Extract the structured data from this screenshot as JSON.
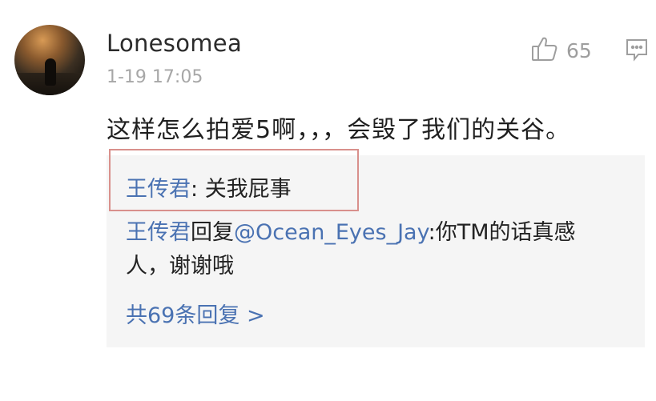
{
  "comment": {
    "username": "Lonesomea",
    "timestamp": "1-19 17:05",
    "like_count": "65",
    "text": "这样怎么拍爱5啊，，，会毁了我们的关谷。",
    "icons": {
      "like": "thumbs-up-icon",
      "reply": "comment-bubble-icon"
    }
  },
  "replies": [
    {
      "author": "王传君",
      "separator": ": ",
      "text": "关我屁事"
    },
    {
      "author": "王传君",
      "action": "回复",
      "mention": "@Ocean_Eyes_Jay",
      "text": ":你TM的话真感人，谢谢哦"
    }
  ],
  "more_replies": "共69条回复 >",
  "colors": {
    "link": "#4a72b2",
    "highlight_border": "#d9908c",
    "reply_bg": "#f5f5f5"
  }
}
